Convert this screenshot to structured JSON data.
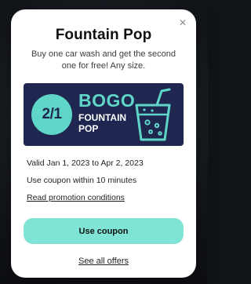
{
  "offer": {
    "close_symbol": "✕",
    "title": "Fountain Pop",
    "subtitle": "Buy one car wash and get the second one for free! Any size.",
    "banner": {
      "badge": "2/1",
      "headline": "BOGO",
      "line1": "FOUNTAIN",
      "line2": "POP",
      "icon": "fountain-drink-icon",
      "colors": {
        "background": "#1f2750",
        "accent": "#5fd6c7"
      }
    },
    "validity": "Valid Jan 1, 2023 to Apr 2, 2023",
    "usage_note": "Use coupon within 10 minutes",
    "conditions_link": "Read promotion conditions",
    "primary_button": "Use coupon",
    "secondary_link": "See all offers"
  },
  "colors": {
    "button": "#7fe3d6",
    "modal_background": "#ffffff"
  }
}
